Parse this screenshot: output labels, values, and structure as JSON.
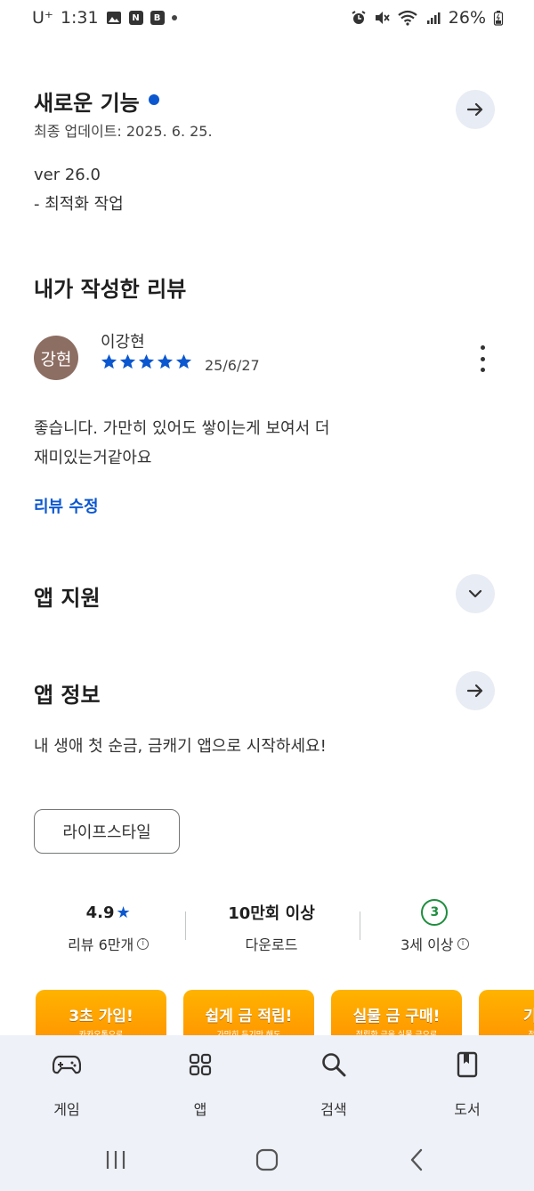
{
  "status_bar": {
    "carrier": "U⁺",
    "time": "1:31",
    "notif_icons": [
      "gallery-icon",
      "naver-icon",
      "b-app-icon"
    ],
    "right_icons": [
      "alarm-icon",
      "mute-icon",
      "wifi-icon",
      "signal-icon"
    ],
    "battery": "26%"
  },
  "whats_new": {
    "title": "새로운 기능",
    "updated": "최종 업데이트: 2025. 6. 25.",
    "version": "ver 26.0",
    "notes": "- 최적화 작업"
  },
  "my_review": {
    "title": "내가 작성한 리뷰",
    "avatar_text": "강현",
    "reviewer": "이강현",
    "rating": 5,
    "date": "25/6/27",
    "text_line1": "좋습니다. 가만히 있어도 쌓이는게 보여서 더",
    "text_line2": "재미있는거같아요",
    "edit_label": "리뷰 수정"
  },
  "app_support": {
    "title": "앱 지원"
  },
  "app_info": {
    "title": "앱 정보",
    "description": "내 생애 첫 순금, 금캐기 앱으로 시작하세요!",
    "category_chip": "라이프스타일"
  },
  "stats": {
    "rating": "4.9",
    "rating_star": "★",
    "reviews": "리뷰 6만개",
    "downloads": "10만회 이상",
    "downloads_label": "다운로드",
    "age_badge": "3",
    "age_label": "3세 이상"
  },
  "banners": [
    {
      "title": "3초 가입!",
      "sub": "카카오톡으로"
    },
    {
      "title": "쉽게 금 적립!",
      "sub": "가만히 두기만 해도"
    },
    {
      "title": "실물 금 구매!",
      "sub": "적립한 금을 실물 금으로"
    },
    {
      "title": "기프티",
      "sub": "적립한 금"
    }
  ],
  "bottom_nav": [
    {
      "label": "게임",
      "icon": "gamepad-icon"
    },
    {
      "label": "앱",
      "icon": "apps-grid-icon"
    },
    {
      "label": "검색",
      "icon": "search-icon"
    },
    {
      "label": "도서",
      "icon": "book-icon"
    }
  ],
  "colors": {
    "accent": "#0b57d0",
    "avatar_bg": "#8d6e63",
    "banner": "#ffa000",
    "nav_bg": "#eef1f8",
    "age_green": "#1e8e3e"
  }
}
